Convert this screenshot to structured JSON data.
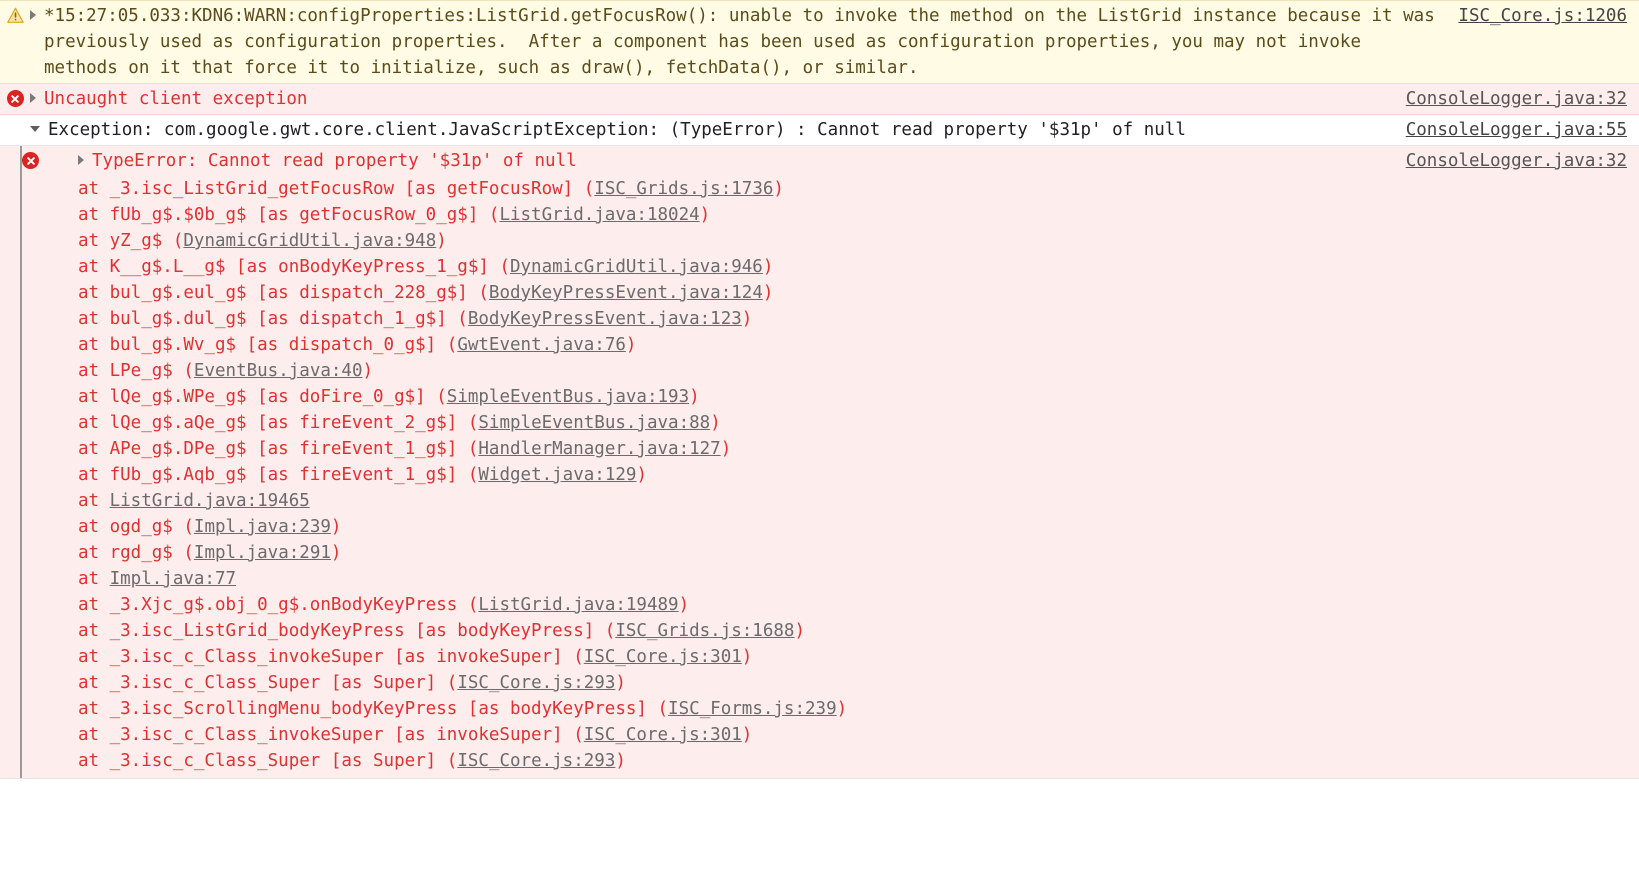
{
  "colors": {
    "warning_bg": "#fffbe5",
    "warning_text": "#5c4b1a",
    "error_bg": "#fdeded",
    "error_text": "#e03131",
    "plain_bg": "#ffffff",
    "plain_text": "#202124",
    "link": "#555555",
    "error_icon": "#dd2222",
    "warning_icon": "#f2c12e",
    "group_bar": "#9a9a9a"
  },
  "icons": {
    "warning": "warning-triangle-icon",
    "error": "error-circle-icon",
    "expand": "disclosure-triangle-right-icon",
    "collapse": "disclosure-triangle-down-icon"
  },
  "rows": [
    {
      "kind": "warning",
      "text": "*15:27:05.033:KDN6:WARN:configProperties:ListGrid.getFocusRow(): unable to invoke the method on the ListGrid instance because it was previously used as configuration properties.  After a component has been used as configuration properties, you may not invoke methods on it that force it to initialize, such as draw(), fetchData(), or similar.",
      "source": "ISC_Core.js:1206"
    },
    {
      "kind": "error",
      "text": "Uncaught client exception",
      "source": "ConsoleLogger.java:32"
    },
    {
      "kind": "plain",
      "text": "Exception: com.google.gwt.core.client.JavaScriptException: (TypeError) : Cannot read property '$31p' of null",
      "source": "ConsoleLogger.java:55"
    },
    {
      "kind": "nested",
      "text": "TypeError: Cannot read property '$31p' of null",
      "source": "ConsoleLogger.java:32"
    }
  ],
  "stack": [
    {
      "at": "at ",
      "fn": "_3.isc_ListGrid_getFocusRow [as getFocusRow] ",
      "open": "(",
      "loc": "ISC_Grids.js:1736",
      "close": ")"
    },
    {
      "at": "at ",
      "fn": "fUb_g$.$0b_g$ [as getFocusRow_0_g$] ",
      "open": "(",
      "loc": "ListGrid.java:18024",
      "close": ")"
    },
    {
      "at": "at ",
      "fn": "yZ_g$ ",
      "open": "(",
      "loc": "DynamicGridUtil.java:948",
      "close": ")"
    },
    {
      "at": "at ",
      "fn": "K__g$.L__g$ [as onBodyKeyPress_1_g$] ",
      "open": "(",
      "loc": "DynamicGridUtil.java:946",
      "close": ")"
    },
    {
      "at": "at ",
      "fn": "bul_g$.eul_g$ [as dispatch_228_g$] ",
      "open": "(",
      "loc": "BodyKeyPressEvent.java:124",
      "close": ")"
    },
    {
      "at": "at ",
      "fn": "bul_g$.dul_g$ [as dispatch_1_g$] ",
      "open": "(",
      "loc": "BodyKeyPressEvent.java:123",
      "close": ")"
    },
    {
      "at": "at ",
      "fn": "bul_g$.Wv_g$ [as dispatch_0_g$] ",
      "open": "(",
      "loc": "GwtEvent.java:76",
      "close": ")"
    },
    {
      "at": "at ",
      "fn": "LPe_g$ ",
      "open": "(",
      "loc": "EventBus.java:40",
      "close": ")"
    },
    {
      "at": "at ",
      "fn": "lQe_g$.WPe_g$ [as doFire_0_g$] ",
      "open": "(",
      "loc": "SimpleEventBus.java:193",
      "close": ")"
    },
    {
      "at": "at ",
      "fn": "lQe_g$.aQe_g$ [as fireEvent_2_g$] ",
      "open": "(",
      "loc": "SimpleEventBus.java:88",
      "close": ")"
    },
    {
      "at": "at ",
      "fn": "APe_g$.DPe_g$ [as fireEvent_1_g$] ",
      "open": "(",
      "loc": "HandlerManager.java:127",
      "close": ")"
    },
    {
      "at": "at ",
      "fn": "fUb_g$.Aqb_g$ [as fireEvent_1_g$] ",
      "open": "(",
      "loc": "Widget.java:129",
      "close": ")"
    },
    {
      "at": "at ",
      "fn": "",
      "open": "",
      "loc": "ListGrid.java:19465",
      "close": ""
    },
    {
      "at": "at ",
      "fn": "ogd_g$ ",
      "open": "(",
      "loc": "Impl.java:239",
      "close": ")"
    },
    {
      "at": "at ",
      "fn": "rgd_g$ ",
      "open": "(",
      "loc": "Impl.java:291",
      "close": ")"
    },
    {
      "at": "at ",
      "fn": "",
      "open": "",
      "loc": "Impl.java:77",
      "close": ""
    },
    {
      "at": "at ",
      "fn": "_3.Xjc_g$.obj_0_g$.onBodyKeyPress ",
      "open": "(",
      "loc": "ListGrid.java:19489",
      "close": ")"
    },
    {
      "at": "at ",
      "fn": "_3.isc_ListGrid_bodyKeyPress [as bodyKeyPress] ",
      "open": "(",
      "loc": "ISC_Grids.js:1688",
      "close": ")"
    },
    {
      "at": "at ",
      "fn": "_3.isc_c_Class_invokeSuper [as invokeSuper] ",
      "open": "(",
      "loc": "ISC_Core.js:301",
      "close": ")"
    },
    {
      "at": "at ",
      "fn": "_3.isc_c_Class_Super [as Super] ",
      "open": "(",
      "loc": "ISC_Core.js:293",
      "close": ")"
    },
    {
      "at": "at ",
      "fn": "_3.isc_ScrollingMenu_bodyKeyPress [as bodyKeyPress] ",
      "open": "(",
      "loc": "ISC_Forms.js:239",
      "close": ")"
    },
    {
      "at": "at ",
      "fn": "_3.isc_c_Class_invokeSuper [as invokeSuper] ",
      "open": "(",
      "loc": "ISC_Core.js:301",
      "close": ")"
    },
    {
      "at": "at ",
      "fn": "_3.isc_c_Class_Super [as Super] ",
      "open": "(",
      "loc": "ISC_Core.js:293",
      "close": ")"
    }
  ]
}
